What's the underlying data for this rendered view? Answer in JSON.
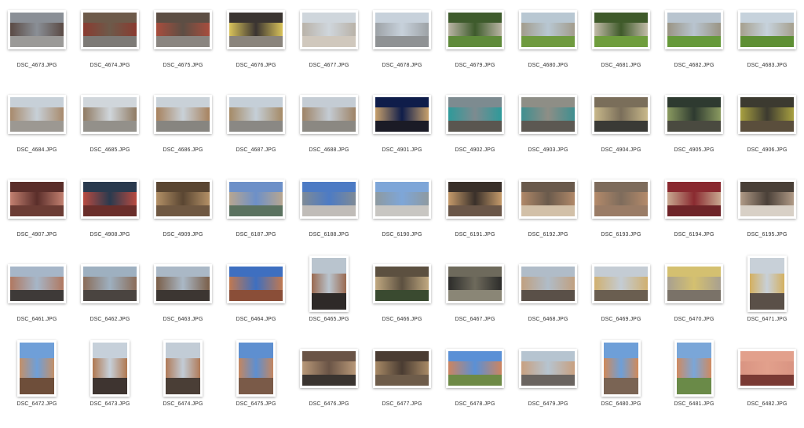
{
  "files": [
    {
      "name": "DSC_4673.JPG",
      "o": "l",
      "c": [
        "#8a8f96",
        "#5a4a44",
        "#9b9a98"
      ]
    },
    {
      "name": "DSC_4674.JPG",
      "o": "l",
      "c": [
        "#6d5a4a",
        "#8a3b30",
        "#7d7a76"
      ]
    },
    {
      "name": "DSC_4675.JPG",
      "o": "l",
      "c": [
        "#5d4e44",
        "#a84d3d",
        "#8a8580"
      ]
    },
    {
      "name": "DSC_4676.JPG",
      "o": "l",
      "c": [
        "#3a3431",
        "#d8c25a",
        "#8a847c"
      ]
    },
    {
      "name": "DSC_4677.JPG",
      "o": "l",
      "c": [
        "#cfd6dc",
        "#b9b2a8",
        "#d0c8bd"
      ]
    },
    {
      "name": "DSC_4678.JPG",
      "o": "l",
      "c": [
        "#c7d1db",
        "#9da2a6",
        "#8f9294"
      ]
    },
    {
      "name": "DSC_4679.JPG",
      "o": "l",
      "c": [
        "#3e5b2c",
        "#b9b4a4",
        "#5f8a3a"
      ]
    },
    {
      "name": "DSC_4680.JPG",
      "o": "l",
      "c": [
        "#b8c7d2",
        "#a29c8c",
        "#6f9a3f"
      ]
    },
    {
      "name": "DSC_4681.JPG",
      "o": "l",
      "c": [
        "#3f5a2a",
        "#c1bba8",
        "#6f9d3d"
      ]
    },
    {
      "name": "DSC_4682.JPG",
      "o": "l",
      "c": [
        "#b8c4cf",
        "#9a9484",
        "#66993a"
      ]
    },
    {
      "name": "DSC_4683.JPG",
      "o": "l",
      "c": [
        "#c6d2dc",
        "#a6a08e",
        "#5e8f34"
      ]
    },
    {
      "name": "DSC_4684.JPG",
      "o": "l",
      "c": [
        "#c7d0d8",
        "#a88a6c",
        "#9c9892"
      ]
    },
    {
      "name": "DSC_4685.JPG",
      "o": "l",
      "c": [
        "#d0d6db",
        "#8f7a62",
        "#93908a"
      ]
    },
    {
      "name": "DSC_4686.JPG",
      "o": "l",
      "c": [
        "#c9d1d8",
        "#a7825e",
        "#878580"
      ]
    },
    {
      "name": "DSC_4687.JPG",
      "o": "l",
      "c": [
        "#c5cfd8",
        "#a58a66",
        "#8a8884"
      ]
    },
    {
      "name": "DSC_4688.JPG",
      "o": "l",
      "c": [
        "#c4ccd4",
        "#9e8366",
        "#8b8882"
      ]
    },
    {
      "name": "DSC_4901.JPG",
      "o": "l",
      "c": [
        "#0f1d4a",
        "#c7a06c",
        "#1b1b26"
      ]
    },
    {
      "name": "DSC_4902.JPG",
      "o": "l",
      "c": [
        "#7d8b90",
        "#2e9a9a",
        "#5a5650"
      ]
    },
    {
      "name": "DSC_4903.JPG",
      "o": "l",
      "c": [
        "#8e8e86",
        "#3f8f90",
        "#5c5852"
      ]
    },
    {
      "name": "DSC_4904.JPG",
      "o": "l",
      "c": [
        "#7a6e5a",
        "#c8b88a",
        "#3a3a36"
      ]
    },
    {
      "name": "DSC_4905.JPG",
      "o": "l",
      "c": [
        "#2e3a30",
        "#8a9a60",
        "#4a4a40"
      ]
    },
    {
      "name": "DSC_4906.JPG",
      "o": "l",
      "c": [
        "#3c3a30",
        "#a8a040",
        "#5a4e3c"
      ]
    },
    {
      "name": "DSC_4907.JPG",
      "o": "l",
      "c": [
        "#5a2e2a",
        "#c28070",
        "#6b3c34"
      ]
    },
    {
      "name": "DSC_4908.JPG",
      "o": "l",
      "c": [
        "#2a3a4e",
        "#b84a40",
        "#6a2e2a"
      ]
    },
    {
      "name": "DSC_4909.JPG",
      "o": "l",
      "c": [
        "#5a4632",
        "#b39066",
        "#6f5842"
      ]
    },
    {
      "name": "DSC_6187.JPG",
      "o": "l",
      "c": [
        "#6d90c8",
        "#b7a690",
        "#5b7260"
      ]
    },
    {
      "name": "DSC_6188.JPG",
      "o": "l",
      "c": [
        "#4d7bc4",
        "#7e8a96",
        "#c0bcb8"
      ]
    },
    {
      "name": "DSC_6190.JPG",
      "o": "l",
      "c": [
        "#7ea6d8",
        "#8e9aa0",
        "#c8c6c2"
      ]
    },
    {
      "name": "DSC_6191.JPG",
      "o": "l",
      "c": [
        "#3a302a",
        "#c49a6a",
        "#6a5648"
      ]
    },
    {
      "name": "DSC_6192.JPG",
      "o": "l",
      "c": [
        "#6a5a4c",
        "#b08868",
        "#d2c0a8"
      ]
    },
    {
      "name": "DSC_6193.JPG",
      "o": "l",
      "c": [
        "#7e6c5c",
        "#b48a6a",
        "#9a7c66"
      ]
    },
    {
      "name": "DSC_6194.JPG",
      "o": "l",
      "c": [
        "#8a2a30",
        "#c8a890",
        "#6e2428"
      ]
    },
    {
      "name": "DSC_6195.JPG",
      "o": "l",
      "c": [
        "#4a4038",
        "#b09a86",
        "#d8d0c6"
      ]
    },
    {
      "name": "DSC_6461.JPG",
      "o": "l",
      "c": [
        "#a6b6c8",
        "#b07860",
        "#3e3a38"
      ]
    },
    {
      "name": "DSC_6462.JPG",
      "o": "l",
      "c": [
        "#9eb0c0",
        "#8a6c58",
        "#4a4440"
      ]
    },
    {
      "name": "DSC_6463.JPG",
      "o": "l",
      "c": [
        "#aab8c6",
        "#7a5e48",
        "#3c3632"
      ]
    },
    {
      "name": "DSC_6464.JPG",
      "o": "l",
      "c": [
        "#3e6fc0",
        "#c07850",
        "#8a4e38"
      ]
    },
    {
      "name": "DSC_6465.JPG",
      "o": "p",
      "c": [
        "#b9c4ce",
        "#9a6a50",
        "#2e2a28"
      ]
    },
    {
      "name": "DSC_6466.JPG",
      "o": "l",
      "c": [
        "#5c5040",
        "#c0a880",
        "#3a4a30"
      ]
    },
    {
      "name": "DSC_6467.JPG",
      "o": "l",
      "c": [
        "#6e6a5c",
        "#2c2c2a",
        "#8a8676"
      ]
    },
    {
      "name": "DSC_6468.JPG",
      "o": "l",
      "c": [
        "#b0bcc8",
        "#c0a080",
        "#5a5048"
      ]
    },
    {
      "name": "DSC_6469.JPG",
      "o": "l",
      "c": [
        "#c4ccd4",
        "#d0b070",
        "#6a5e50"
      ]
    },
    {
      "name": "DSC_6470.JPG",
      "o": "l",
      "c": [
        "#d4c070",
        "#a8a090",
        "#7a7268"
      ]
    },
    {
      "name": "DSC_6471.JPG",
      "o": "p",
      "c": [
        "#c8d0d8",
        "#d4b060",
        "#5a5048"
      ]
    },
    {
      "name": "DSC_6472.JPG",
      "o": "p",
      "c": [
        "#6f9fd8",
        "#c49068",
        "#6e4e3a"
      ]
    },
    {
      "name": "DSC_6473.JPG",
      "o": "p",
      "c": [
        "#c6d0da",
        "#b07850",
        "#3e3430"
      ]
    },
    {
      "name": "DSC_6474.JPG",
      "o": "p",
      "c": [
        "#c2ccd6",
        "#b07a58",
        "#4a3e36"
      ]
    },
    {
      "name": "DSC_6475.JPG",
      "o": "p",
      "c": [
        "#5e8fd0",
        "#c48660",
        "#7a5a48"
      ]
    },
    {
      "name": "DSC_6476.JPG",
      "o": "l",
      "c": [
        "#6a5446",
        "#b89878",
        "#3a3430"
      ]
    },
    {
      "name": "DSC_6477.JPG",
      "o": "l",
      "c": [
        "#4a3c32",
        "#a88a66",
        "#6e5c4a"
      ]
    },
    {
      "name": "DSC_6478.JPG",
      "o": "l",
      "c": [
        "#5a90d6",
        "#cc8460",
        "#6e8a46"
      ]
    },
    {
      "name": "DSC_6479.JPG",
      "o": "l",
      "c": [
        "#b6c4d0",
        "#c8a080",
        "#6a6460"
      ]
    },
    {
      "name": "DSC_6480.JPG",
      "o": "p",
      "c": [
        "#6e9fd8",
        "#d08a5a",
        "#7a6454"
      ]
    },
    {
      "name": "DSC_6481.JPG",
      "o": "p",
      "c": [
        "#7aa6d8",
        "#d08a60",
        "#6a8a48"
      ]
    },
    {
      "name": "DSC_6482.JPG",
      "o": "l",
      "c": [
        "#e2a08c",
        "#d99482",
        "#7a3a34"
      ]
    }
  ]
}
